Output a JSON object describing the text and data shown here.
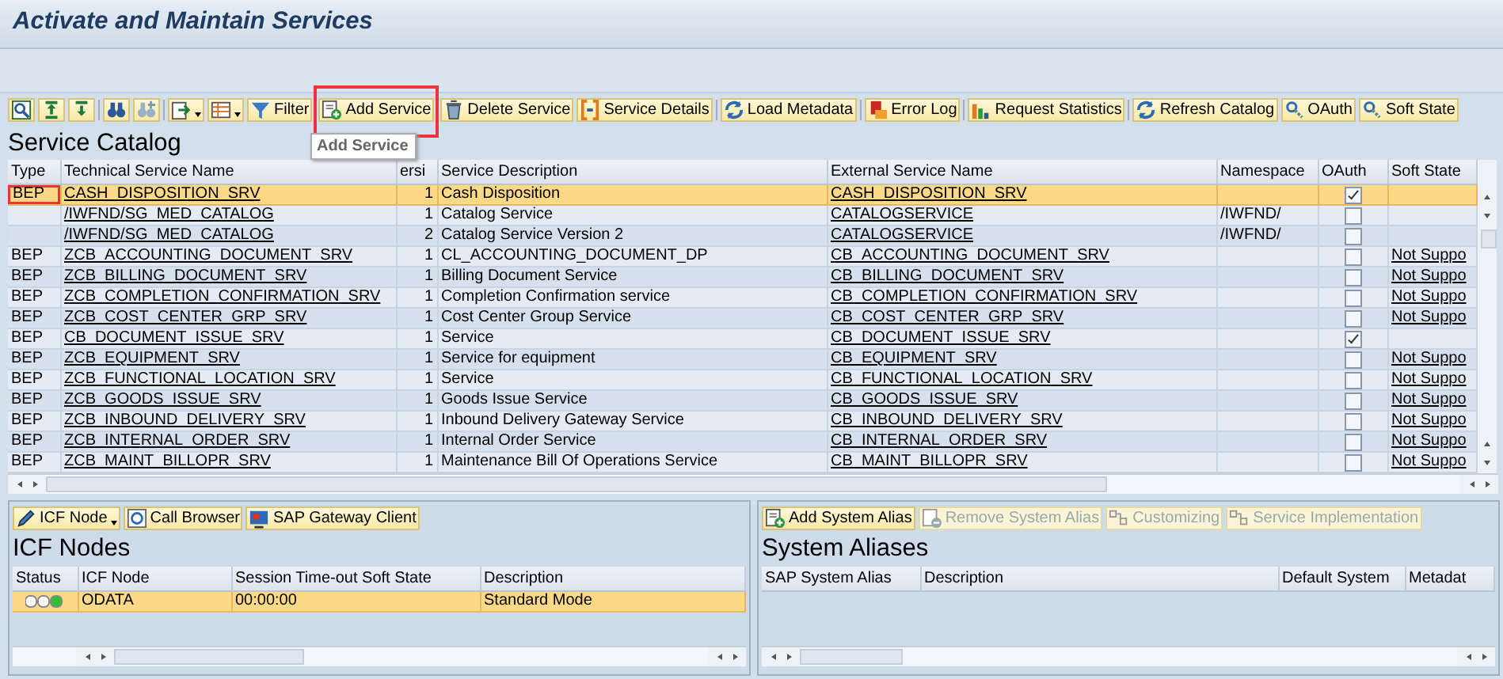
{
  "window": {
    "title": "Activate and Maintain Services"
  },
  "toolbar": [
    {
      "kind": "icon",
      "dropdown": false,
      "highlighted": false
    },
    {
      "kind": "icon",
      "dropdown": false,
      "highlighted": false
    },
    {
      "kind": "icon",
      "dropdown": false,
      "highlighted": false
    },
    {
      "kind": "icon",
      "dropdown": false,
      "highlighted": false
    },
    {
      "kind": "icon",
      "dropdown": false,
      "highlighted": false
    },
    {
      "kind": "icon",
      "dropdown": true,
      "highlighted": false
    },
    {
      "kind": "icon",
      "dropdown": true,
      "highlighted": false
    },
    {
      "kind": "text",
      "label": "Filter",
      "dropdown": false,
      "highlighted": false
    },
    {
      "kind": "text",
      "label": "Add Service",
      "dropdown": false,
      "highlighted": true
    },
    {
      "kind": "text",
      "label": "Delete Service",
      "dropdown": false,
      "highlighted": false
    },
    {
      "kind": "text",
      "label": "Service Details",
      "dropdown": false,
      "highlighted": false
    },
    {
      "kind": "text",
      "label": "Load Metadata",
      "dropdown": false,
      "highlighted": false
    },
    {
      "kind": "text",
      "label": "Error Log",
      "dropdown": false,
      "highlighted": false
    },
    {
      "kind": "text",
      "label": "Request Statistics",
      "dropdown": false,
      "highlighted": false
    },
    {
      "kind": "text",
      "label": "Refresh Catalog",
      "dropdown": false,
      "highlighted": false
    },
    {
      "kind": "text",
      "label": "OAuth",
      "dropdown": false,
      "highlighted": false
    },
    {
      "kind": "text",
      "label": "Soft State",
      "dropdown": false,
      "highlighted": false
    }
  ],
  "tooltip": {
    "text": "Add Service"
  },
  "service_catalog": {
    "title": "Service Catalog",
    "columns": [
      "Type",
      "Technical Service Name",
      "ersi",
      "Service Description",
      "External Service Name",
      "Namespace",
      "OAuth",
      "Soft State"
    ],
    "rows": [
      {
        "type": "BEP",
        "technical_service_name": "CASH_DISPOSITION_SRV",
        "version": "1",
        "service_description": "Cash Disposition",
        "external_service_name": "CASH_DISPOSITION_SRV",
        "namespace": "",
        "oauth": true,
        "soft_state": "",
        "selected": true,
        "focused": true
      },
      {
        "type": "",
        "technical_service_name": "/IWFND/SG_MED_CATALOG",
        "version": "1",
        "service_description": "Catalog Service",
        "external_service_name": "CATALOGSERVICE",
        "namespace": "/IWFND/",
        "oauth": false,
        "soft_state": "",
        "selected": false,
        "focused": false
      },
      {
        "type": "",
        "technical_service_name": "/IWFND/SG_MED_CATALOG",
        "version": "2",
        "service_description": "Catalog Service Version 2",
        "external_service_name": "CATALOGSERVICE",
        "namespace": "/IWFND/",
        "oauth": false,
        "soft_state": "",
        "selected": false,
        "focused": false
      },
      {
        "type": "BEP",
        "technical_service_name": "ZCB_ACCOUNTING_DOCUMENT_SRV",
        "version": "1",
        "service_description": "CL_ACCOUNTING_DOCUMENT_DP",
        "external_service_name": "CB_ACCOUNTING_DOCUMENT_SRV",
        "namespace": "",
        "oauth": false,
        "soft_state": "Not Suppo",
        "selected": false,
        "focused": false
      },
      {
        "type": "BEP",
        "technical_service_name": "ZCB_BILLING_DOCUMENT_SRV",
        "version": "1",
        "service_description": "Billing Document Service",
        "external_service_name": "CB_BILLING_DOCUMENT_SRV",
        "namespace": "",
        "oauth": false,
        "soft_state": "Not Suppo",
        "selected": false,
        "focused": false
      },
      {
        "type": "BEP",
        "technical_service_name": "ZCB_COMPLETION_CONFIRMATION_SRV",
        "version": "1",
        "service_description": "Completion Confirmation service",
        "external_service_name": "CB_COMPLETION_CONFIRMATION_SRV",
        "namespace": "",
        "oauth": false,
        "soft_state": "Not Suppo",
        "selected": false,
        "focused": false
      },
      {
        "type": "BEP",
        "technical_service_name": "ZCB_COST_CENTER_GRP_SRV",
        "version": "1",
        "service_description": "Cost Center Group Service",
        "external_service_name": "CB_COST_CENTER_GRP_SRV",
        "namespace": "",
        "oauth": false,
        "soft_state": "Not Suppo",
        "selected": false,
        "focused": false
      },
      {
        "type": "BEP",
        "technical_service_name": "CB_DOCUMENT_ISSUE_SRV",
        "version": "1",
        "service_description": "Service",
        "external_service_name": "CB_DOCUMENT_ISSUE_SRV",
        "namespace": "",
        "oauth": true,
        "soft_state": "",
        "selected": false,
        "focused": false
      },
      {
        "type": "BEP",
        "technical_service_name": "ZCB_EQUIPMENT_SRV",
        "version": "1",
        "service_description": "Service for equipment",
        "external_service_name": "CB_EQUIPMENT_SRV",
        "namespace": "",
        "oauth": false,
        "soft_state": "Not Suppo",
        "selected": false,
        "focused": false
      },
      {
        "type": "BEP",
        "technical_service_name": "ZCB_FUNCTIONAL_LOCATION_SRV",
        "version": "1",
        "service_description": "Service",
        "external_service_name": "CB_FUNCTIONAL_LOCATION_SRV",
        "namespace": "",
        "oauth": false,
        "soft_state": "Not Suppo",
        "selected": false,
        "focused": false
      },
      {
        "type": "BEP",
        "technical_service_name": "ZCB_GOODS_ISSUE_SRV",
        "version": "1",
        "service_description": "Goods Issue Service",
        "external_service_name": "CB_GOODS_ISSUE_SRV",
        "namespace": "",
        "oauth": false,
        "soft_state": "Not Suppo",
        "selected": false,
        "focused": false
      },
      {
        "type": "BEP",
        "technical_service_name": "ZCB_INBOUND_DELIVERY_SRV",
        "version": "1",
        "service_description": "Inbound Delivery Gateway Service",
        "external_service_name": "CB_INBOUND_DELIVERY_SRV",
        "namespace": "",
        "oauth": false,
        "soft_state": "Not Suppo",
        "selected": false,
        "focused": false
      },
      {
        "type": "BEP",
        "technical_service_name": "ZCB_INTERNAL_ORDER_SRV",
        "version": "1",
        "service_description": "Internal Order Service",
        "external_service_name": "CB_INTERNAL_ORDER_SRV",
        "namespace": "",
        "oauth": false,
        "soft_state": "Not Suppo",
        "selected": false,
        "focused": false
      },
      {
        "type": "BEP",
        "technical_service_name": "ZCB_MAINT_BILLOPR_SRV",
        "version": "1",
        "service_description": "Maintenance Bill Of Operations Service",
        "external_service_name": "CB_MAINT_BILLOPR_SRV",
        "namespace": "",
        "oauth": false,
        "soft_state": "Not Suppo",
        "selected": false,
        "focused": false
      }
    ]
  },
  "icf_nodes": {
    "toolbar": [
      {
        "label": "ICF Node",
        "dropdown": true,
        "disabled": false
      },
      {
        "label": "Call Browser",
        "dropdown": false,
        "disabled": false
      },
      {
        "label": "SAP Gateway Client",
        "dropdown": false,
        "disabled": false
      }
    ],
    "title": "ICF Nodes",
    "columns": [
      "Status",
      "ICF Node",
      "Session Time-out Soft State",
      "Description"
    ],
    "rows": [
      {
        "active": true,
        "icf_node": "ODATA",
        "session_timeout": "00:00:00",
        "description": "Standard Mode",
        "selected": true
      }
    ]
  },
  "system_aliases": {
    "toolbar": [
      {
        "label": "Add System Alias",
        "dropdown": false,
        "disabled": false
      },
      {
        "label": "Remove System Alias",
        "dropdown": false,
        "disabled": true
      },
      {
        "label": "Customizing",
        "dropdown": false,
        "disabled": true
      },
      {
        "label": "Service Implementation",
        "dropdown": false,
        "disabled": true
      }
    ],
    "title": "System Aliases",
    "columns": [
      "SAP System Alias",
      "Description",
      "Default System",
      "Metadat"
    ]
  }
}
